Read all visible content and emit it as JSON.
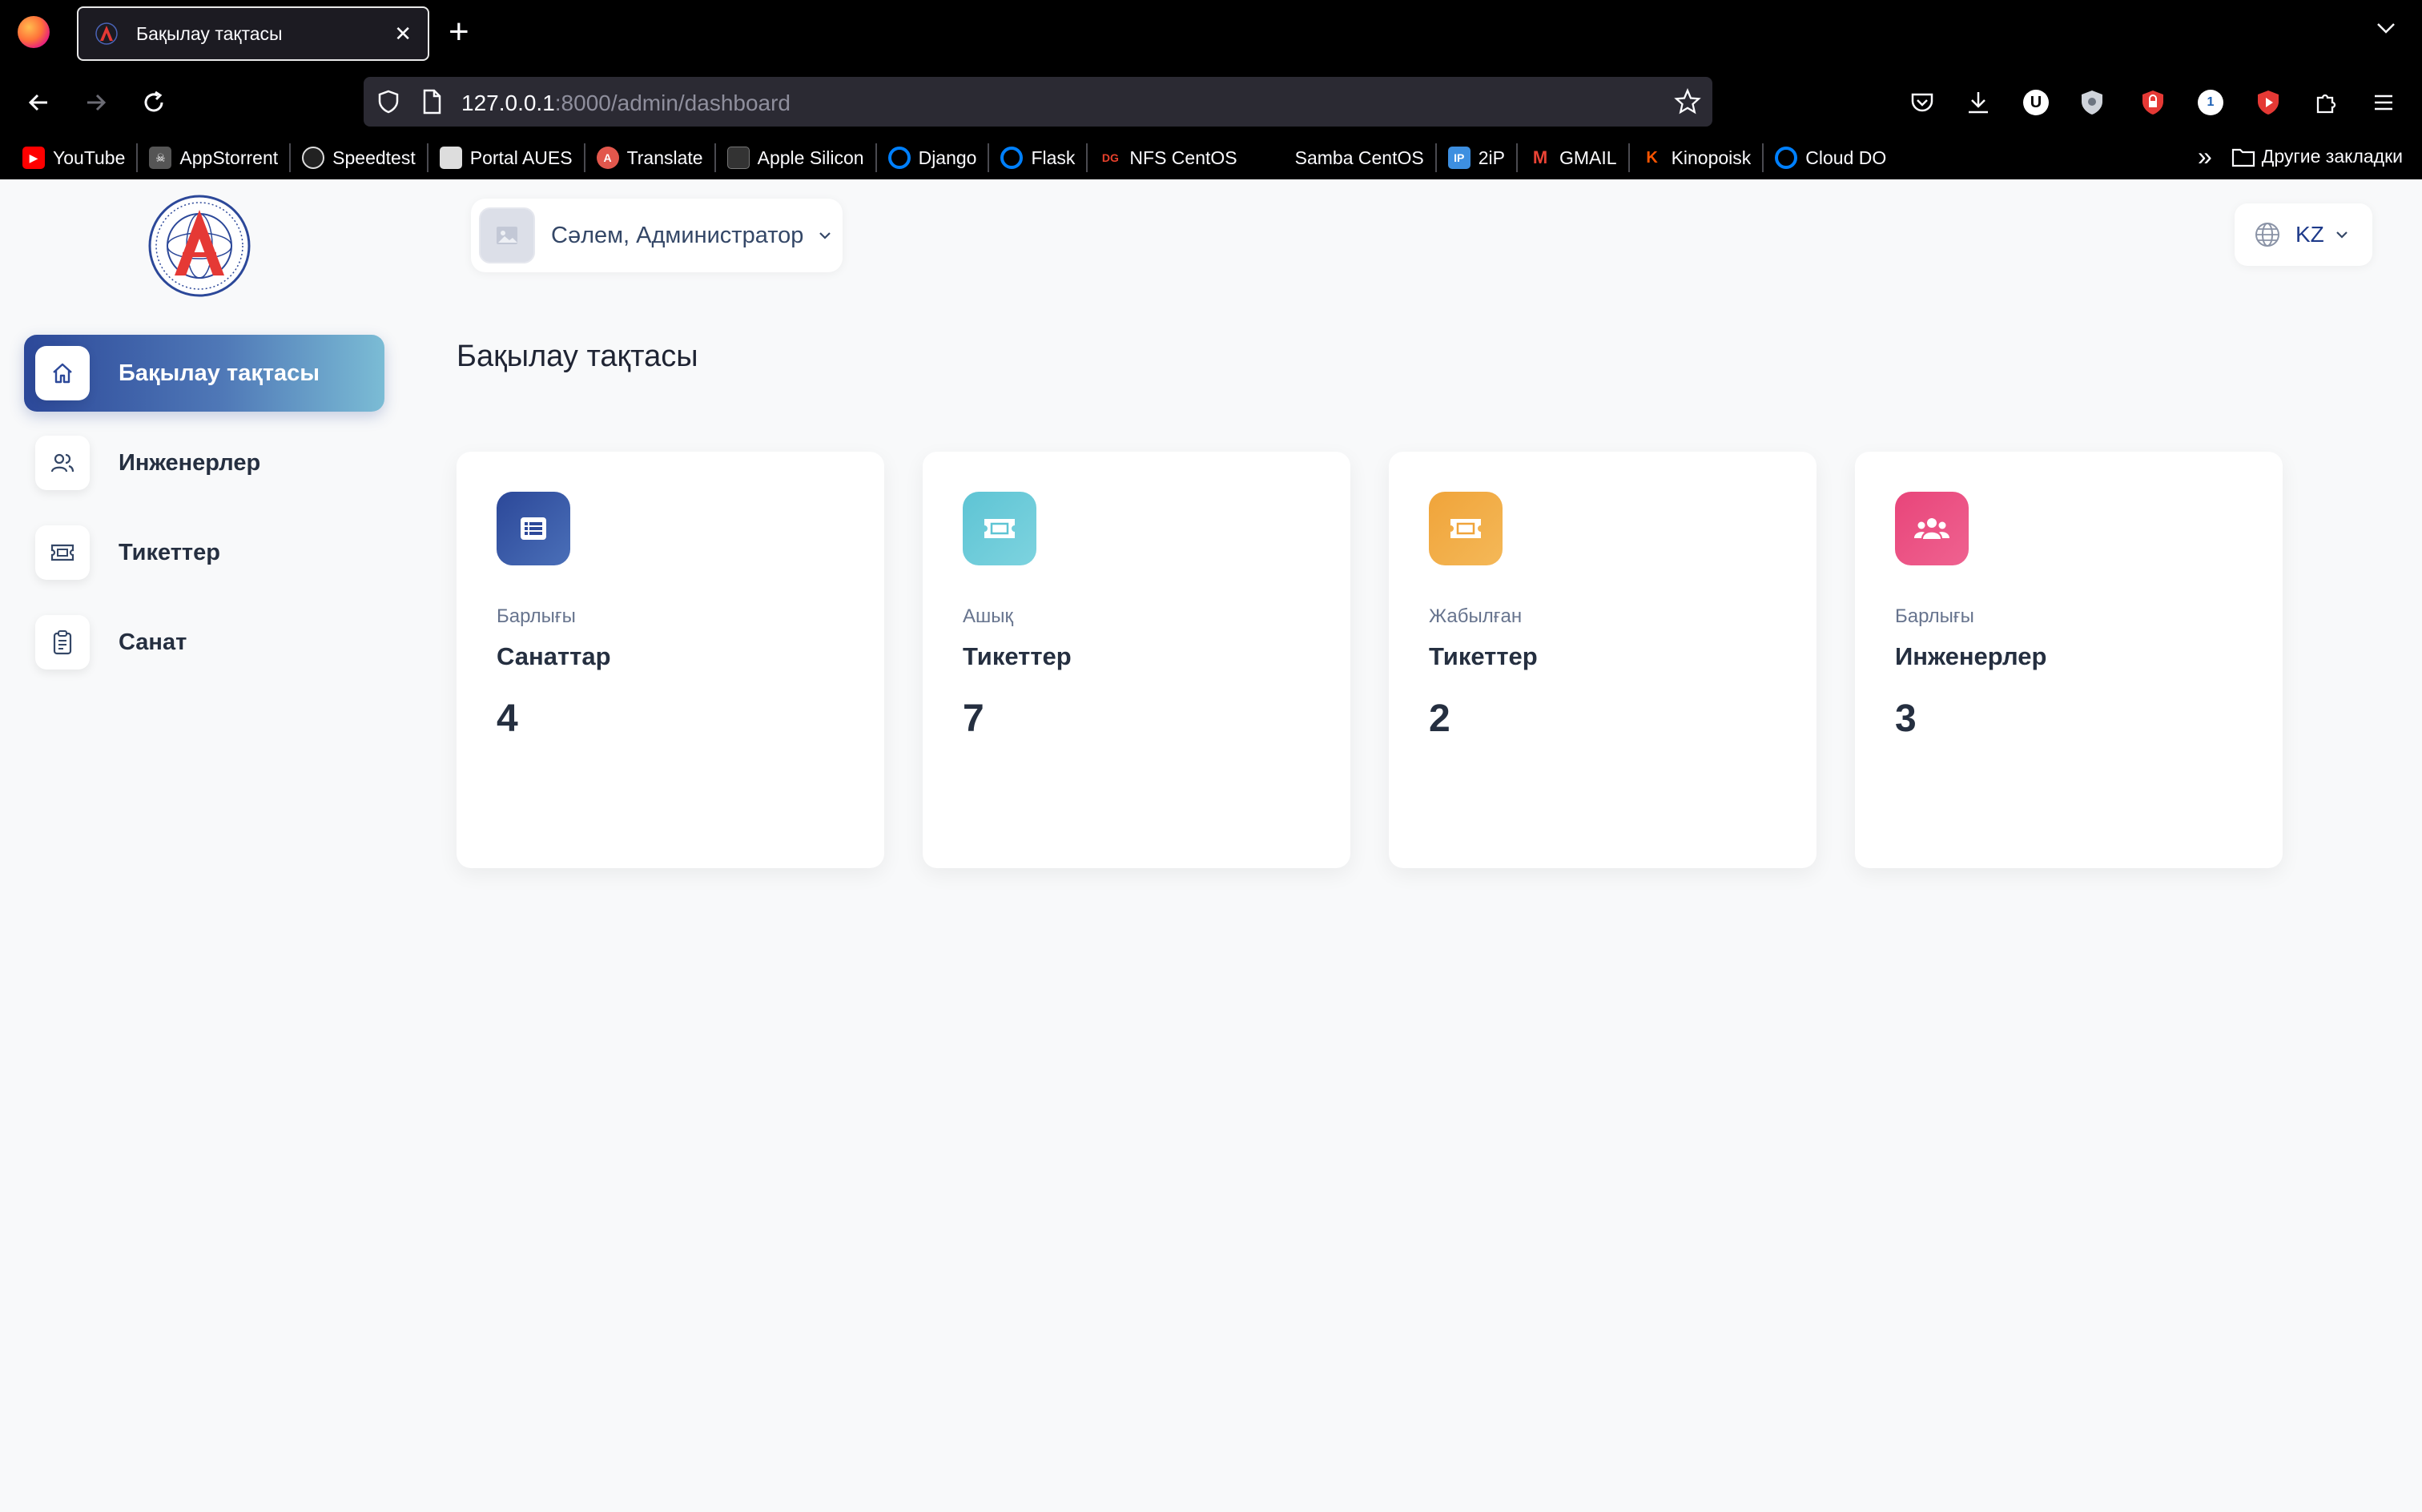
{
  "browser": {
    "tab_title": "Бақылау тақтасы",
    "url_host": "127.0.0.1",
    "url_rest": ":8000/admin/dashboard",
    "bookmarks": [
      {
        "label": "YouTube",
        "icon": "youtube-icon",
        "color": "#ff0000"
      },
      {
        "label": "AppStorrent",
        "icon": "skull-icon",
        "color": "#555555"
      },
      {
        "label": "Speedtest",
        "icon": "speedometer-icon",
        "color": "#222222"
      },
      {
        "label": "Portal AUES",
        "icon": "portal-icon",
        "color": "#dddddd"
      },
      {
        "label": "Translate",
        "icon": "translate-icon",
        "color": "#e2574c"
      },
      {
        "label": "Apple Silicon",
        "icon": "chip-icon",
        "color": "#333333"
      },
      {
        "label": "Django",
        "icon": "cloud-icon",
        "color": "#0080ff"
      },
      {
        "label": "Flask",
        "icon": "cloud-icon",
        "color": "#0080ff"
      },
      {
        "label": "NFS CentOS",
        "icon": "dg-icon",
        "color": "#e8412c"
      },
      {
        "label": "Samba CentOS",
        "icon": "blank-icon",
        "color": "#000000"
      },
      {
        "label": "2iP",
        "icon": "ip-icon",
        "color": "#3d8fe0"
      },
      {
        "label": "GMAIL",
        "icon": "gmail-icon",
        "color": "#ea4335"
      },
      {
        "label": "Kinopoisk",
        "icon": "kinopoisk-icon",
        "color": "#ff5500"
      },
      {
        "label": "Cloud DO",
        "icon": "cloud-icon",
        "color": "#0080ff"
      }
    ],
    "other_bookmarks": "Другие закладки"
  },
  "sidebar": {
    "items": [
      {
        "label": "Бақылау тақтасы",
        "icon": "home-icon",
        "active": true
      },
      {
        "label": "Инженерлер",
        "icon": "users-icon",
        "active": false
      },
      {
        "label": "Тикеттер",
        "icon": "ticket-icon",
        "active": false
      },
      {
        "label": "Санат",
        "icon": "clipboard-icon",
        "active": false
      }
    ]
  },
  "header": {
    "greeting": "Сәлем, Администратор",
    "language": "KZ"
  },
  "main": {
    "title": "Бақылау тақтасы",
    "cards": [
      {
        "subtitle": "Барлығы",
        "title": "Санаттар",
        "value": "4",
        "icon": "list-icon",
        "color": "#2c4899"
      },
      {
        "subtitle": "Ашық",
        "title": "Тикеттер",
        "value": "7",
        "icon": "ticket-icon",
        "color": "#5ec4d4"
      },
      {
        "subtitle": "Жабылған",
        "title": "Тикеттер",
        "value": "2",
        "icon": "ticket-icon",
        "color": "#f0a43a"
      },
      {
        "subtitle": "Барлығы",
        "title": "Инженерлер",
        "value": "3",
        "icon": "users-group-icon",
        "color": "#e8457a"
      }
    ]
  }
}
